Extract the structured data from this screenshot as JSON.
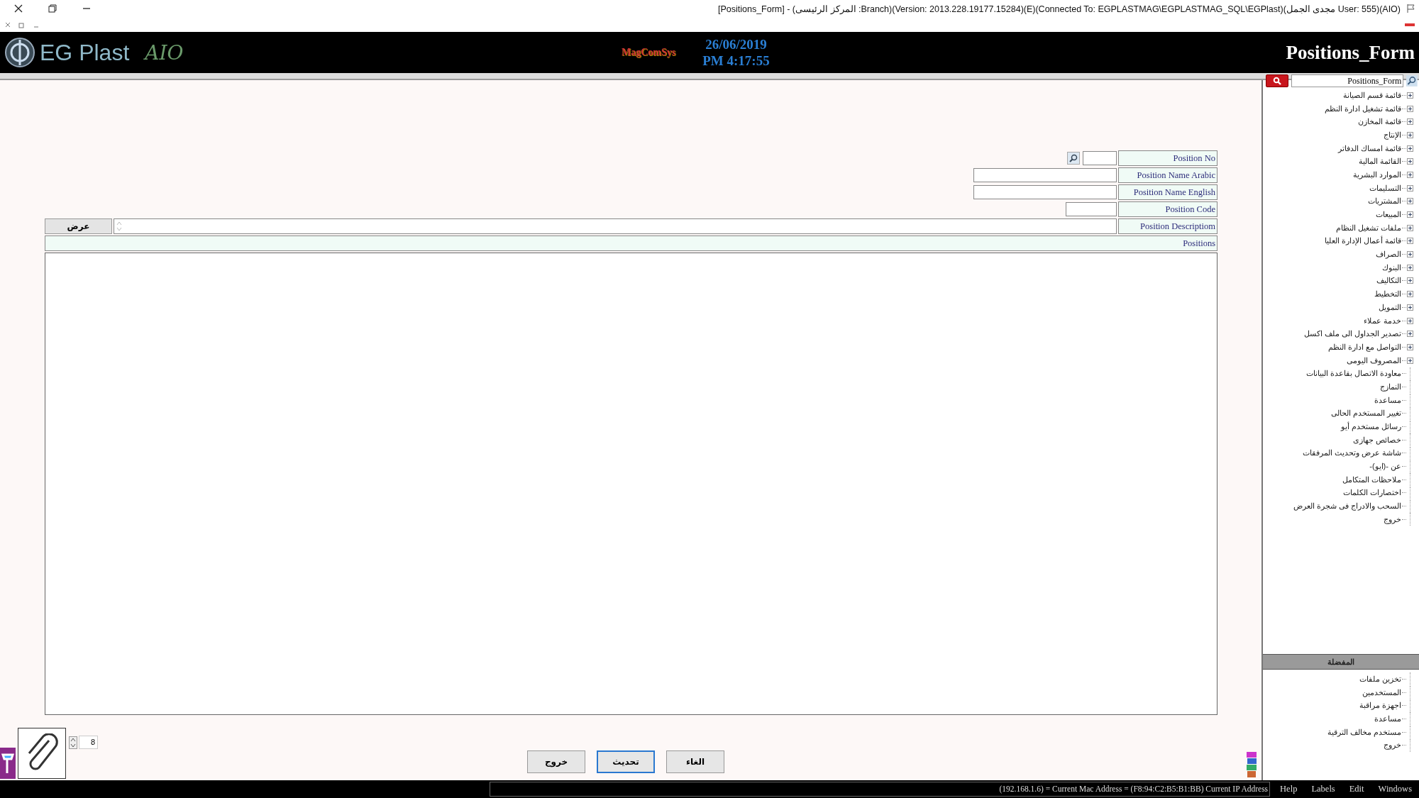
{
  "window": {
    "title": "[Positions_Form] - (المركز الرئيسى :Branch)(Version: 2013.228.19177.15284)(E)(Connected To: EGPLASTMAG\\EGPLASTMAG_SQL\\EGPlast)(مجدى الجمل User: 555)(AIO)"
  },
  "header": {
    "logo_text": "EG Plast",
    "logo_script": "AIO",
    "brand": "MagComSys",
    "date": "26/06/2019",
    "time": "PM 4:17:55",
    "form_title": "Positions_Form"
  },
  "form": {
    "fields": [
      {
        "label": "Position No",
        "kind": "lookup"
      },
      {
        "label": "Position Name Arabic",
        "kind": "text"
      },
      {
        "label": "Position Name English",
        "kind": "text"
      },
      {
        "label": "Position Code",
        "kind": "short"
      },
      {
        "label": "Position Descriptiom",
        "kind": "memo"
      }
    ],
    "view_button": "عرض"
  },
  "grid": {
    "title": "Positions"
  },
  "attachments": {
    "count": "8"
  },
  "buttons": [
    {
      "label": "الغاء",
      "default": false
    },
    {
      "label": "تحديث",
      "default": true
    },
    {
      "label": "خروج",
      "default": false
    }
  ],
  "sidebar": {
    "search_value": "Positions_Form",
    "items": [
      {
        "label": "قائمة قسم الصيانة",
        "kind": "folder"
      },
      {
        "label": "قائمة تشغيل ادارة النظم",
        "kind": "folder"
      },
      {
        "label": "قائمة المخازن",
        "kind": "folder"
      },
      {
        "label": "الإنتاج",
        "kind": "folder"
      },
      {
        "label": "قائمة امساك الدفاتر",
        "kind": "folder"
      },
      {
        "label": "القائمة المالية",
        "kind": "folder"
      },
      {
        "label": "الموارد البشرية",
        "kind": "folder"
      },
      {
        "label": "التسليمات",
        "kind": "folder"
      },
      {
        "label": "المشتريات",
        "kind": "folder"
      },
      {
        "label": "المبيعات",
        "kind": "folder"
      },
      {
        "label": "ملفات تشغيل النظام",
        "kind": "folder"
      },
      {
        "label": "قائمة أعمال الإدارة العليا",
        "kind": "folder"
      },
      {
        "label": "الصراف",
        "kind": "folder"
      },
      {
        "label": "البنوك",
        "kind": "folder"
      },
      {
        "label": "التكاليف",
        "kind": "folder"
      },
      {
        "label": "التخطيط",
        "kind": "folder"
      },
      {
        "label": "التمويل",
        "kind": "folder"
      },
      {
        "label": "خدمة عملاء",
        "kind": "folder"
      },
      {
        "label": "تصدير الجداول الى ملف اكسل",
        "kind": "folder"
      },
      {
        "label": "التواصل مع ادارة النظم",
        "kind": "folder"
      },
      {
        "label": "المصروف اليومى",
        "kind": "folder"
      },
      {
        "label": "معاودة الاتصال بقاعدة البيانات",
        "kind": "leaf"
      },
      {
        "label": "النمازج",
        "kind": "leaf"
      },
      {
        "label": "مساعدة",
        "kind": "leaf"
      },
      {
        "label": "تغيير المستخدم الحالى",
        "kind": "leaf"
      },
      {
        "label": "رسائل مستخدم أيو",
        "kind": "leaf"
      },
      {
        "label": "خصائص جهازى",
        "kind": "leaf"
      },
      {
        "label": "شاشة عرض وتحديث المرفقات",
        "kind": "leaf"
      },
      {
        "label": "عن -(ايو)-",
        "kind": "leaf"
      },
      {
        "label": "ملاحظات المتكامل",
        "kind": "leaf"
      },
      {
        "label": "اختصارات الكلمات",
        "kind": "leaf"
      },
      {
        "label": "السحب والادراج فى شجرة العرض",
        "kind": "leaf"
      },
      {
        "label": "خروج",
        "kind": "leaf"
      }
    ],
    "favorites_title": "المفضلة",
    "favorites": [
      "تخزين ملفات",
      "المستخدمين",
      "اجهزة مراقبة",
      "مساعدة",
      "مستخدم مخالف الترقية",
      "خروج"
    ]
  },
  "status_bar": {
    "address": "(192.168.1.6) = Current Mac Address = (F8:94:C2:B5:B1:BB) Current IP Address",
    "menu": [
      "Windows",
      "Edit",
      "Labels",
      "Help"
    ]
  }
}
